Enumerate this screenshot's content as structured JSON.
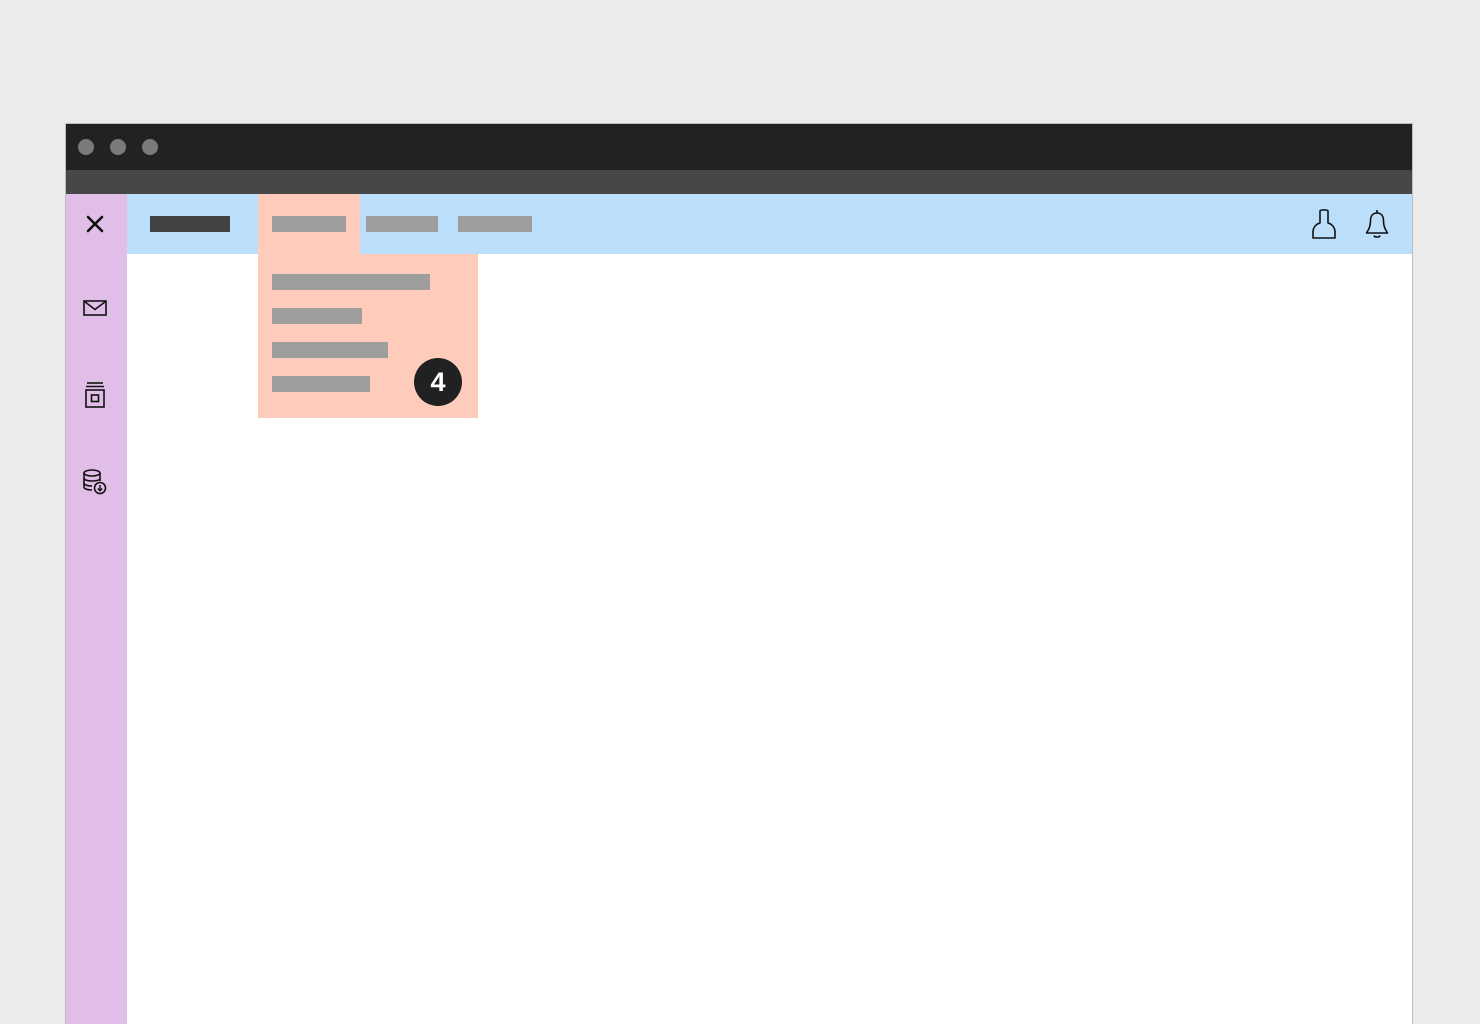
{
  "callout": {
    "number": "4",
    "color": "#212121"
  },
  "colors": {
    "page_background": "#ebebeb",
    "titlebar": "#222222",
    "address_strip": "#474747",
    "side_rail": "#e1bee7",
    "topbar": "#bbdefb",
    "dropdown_highlight": "#ffccbc",
    "placeholder_text": "#9e9e9e",
    "brand_placeholder": "#424242",
    "content": "#ffffff"
  },
  "side_rail": {
    "icons": [
      "close-icon",
      "mail-icon",
      "archive-icon",
      "database-download-icon"
    ]
  },
  "topbar": {
    "icons": [
      "user-icon",
      "bell-icon"
    ],
    "nav_items": [
      "placeholder",
      "placeholder",
      "placeholder"
    ],
    "active_nav_index": 0
  },
  "dropdown": {
    "item_count": 4
  }
}
